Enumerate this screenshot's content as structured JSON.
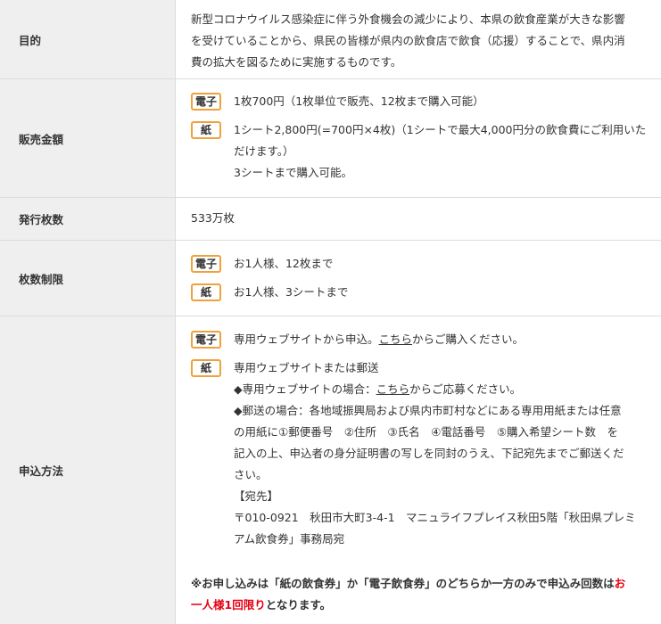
{
  "rows": [
    {
      "label": "目的",
      "lines": [
        "新型コロナウイルス感染症に伴う外食機会の減少により、本県の飲食産業が大きな影響",
        "を受けていることから、県民の皆様が県内の飲食店で飲食（応援）することで、県内消",
        "費の拡大を図るために実施するものです。"
      ]
    },
    {
      "label": "販売金額",
      "electronic_tag": "電子",
      "paper_tag": "紙",
      "electronic_text": "1枚700円（1枚単位で販売、12枚まで購入可能）",
      "paper_line1": "1シート2,800円(=700円×4枚)（1シートで最大4,000円分の飲食費にご利用いた",
      "paper_line2": "だけます。）",
      "paper_line3": "3シートまで購入可能。"
    },
    {
      "label": "発行枚数",
      "value": "533万枚"
    },
    {
      "label": "枚数制限",
      "electronic_tag": "電子",
      "paper_tag": "紙",
      "electronic_text": "お1人様、12枚まで",
      "paper_text": "お1人様、3シートまで"
    },
    {
      "label": "申込方法",
      "electronic_tag": "電子",
      "paper_tag": "紙",
      "electronic_pre": "専用ウェブサイトから申込。",
      "electronic_link": "こちら",
      "electronic_post": "からご購入ください。",
      "paper_intro": "専用ウェブサイトまたは郵送",
      "web_pre": "◆専用ウェブサイトの場合：",
      "web_link": "こちら",
      "web_post": "からご応募ください。",
      "mail_lines": [
        "◆郵送の場合：各地域振興局および県内市町村などにある専用用紙または任意",
        "の用紙に①郵便番号　②住所　③氏名　④電話番号　⑤購入希望シート数　を",
        "記入の上、申込者の身分証明書の写しを同封のうえ、下記宛先までご郵送くだ",
        "さい。"
      ],
      "address_heading": "【宛先】",
      "address_lines": [
        "〒010-0921　秋田市大町3-4-1　マニュライフプレイス秋田5階「秋田県プレミ",
        "アム飲食券」事務局宛"
      ],
      "note_pre": "※お申し込みは「紙の飲食券」か「電子飲食券」のどちらか一方のみで申込み回数は",
      "note_red_1": "お",
      "note_red_2": "一人様1回限り",
      "note_post": "となります。"
    }
  ]
}
